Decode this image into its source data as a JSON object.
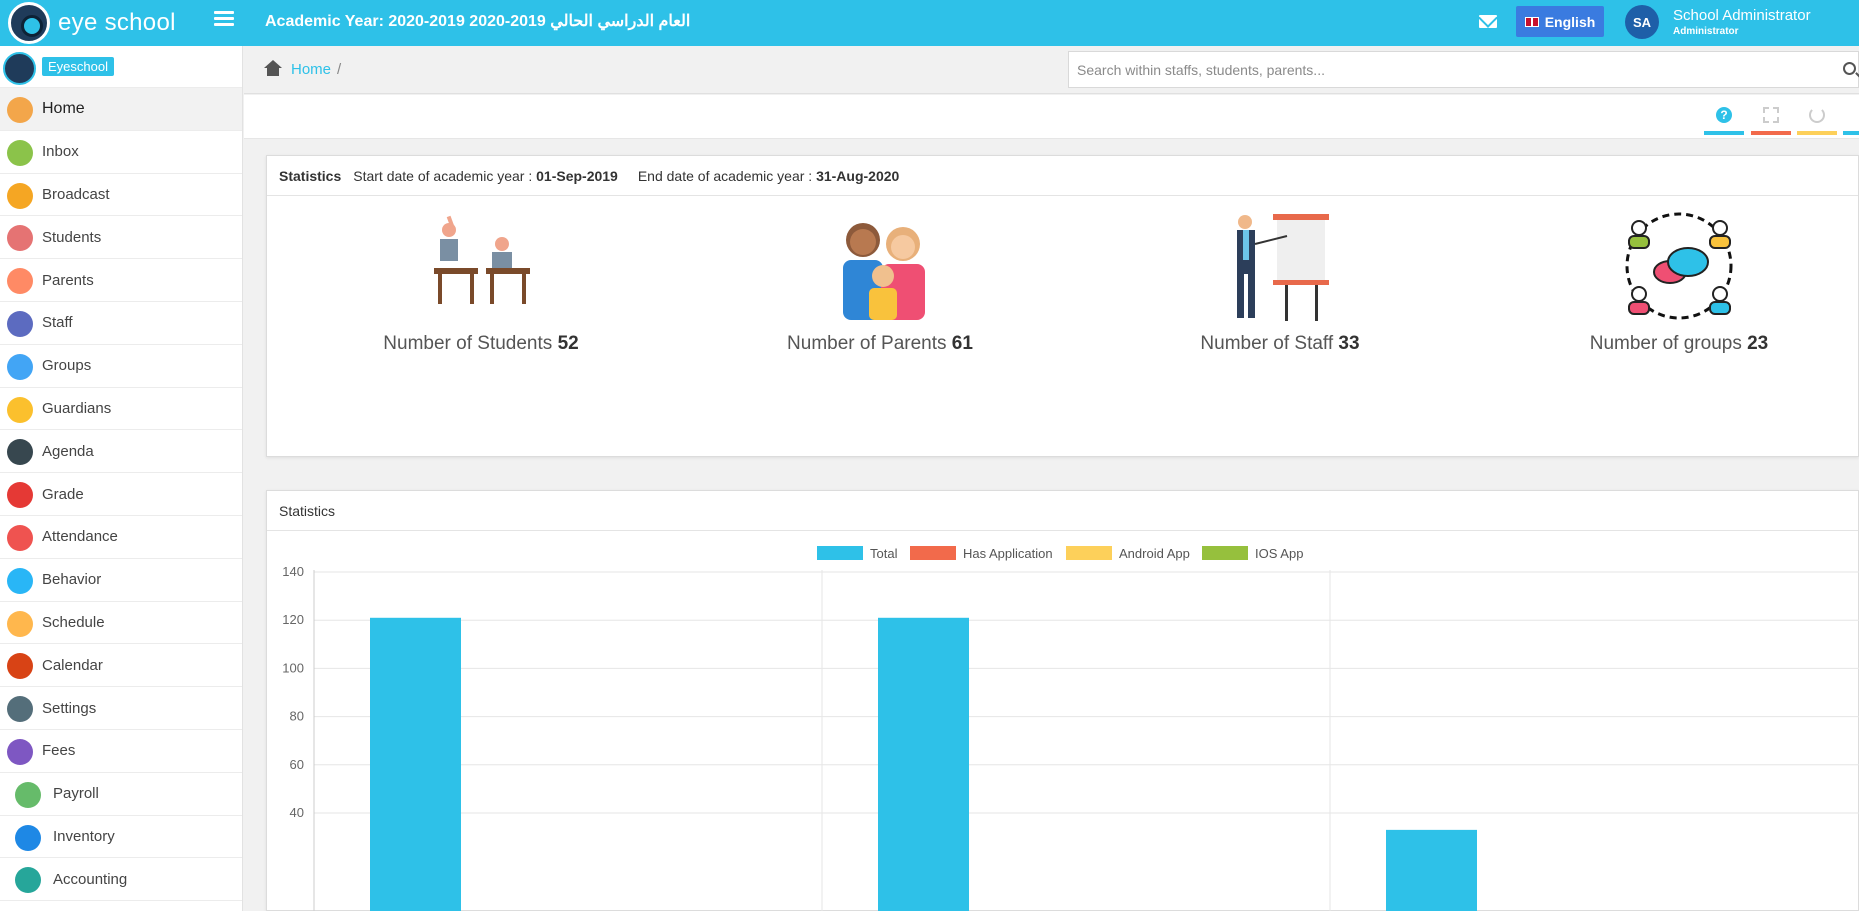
{
  "topbar": {
    "logo_text": "eye school",
    "academic_year": "Academic Year: 2020-2019 العام الدراسي الحالي 2019-2020",
    "language": "English",
    "avatar_initials": "SA",
    "user_name": "School Administrator",
    "user_role": "Administrator"
  },
  "sidebar": {
    "brand_badge": "Eyeschool",
    "items": [
      {
        "label": "Home",
        "color": "#f3a64a"
      },
      {
        "label": "Inbox",
        "color": "#8bc34a"
      },
      {
        "label": "Broadcast",
        "color": "#f5a623"
      },
      {
        "label": "Students",
        "color": "#e57373"
      },
      {
        "label": "Parents",
        "color": "#ff8a65"
      },
      {
        "label": "Staff",
        "color": "#5c6bc0"
      },
      {
        "label": "Groups",
        "color": "#42a5f5"
      },
      {
        "label": "Guardians",
        "color": "#fbc02d"
      },
      {
        "label": "Agenda",
        "color": "#37474f"
      },
      {
        "label": "Grade",
        "color": "#e53935"
      },
      {
        "label": "Attendance",
        "color": "#ef5350"
      },
      {
        "label": "Behavior",
        "color": "#29b6f6"
      },
      {
        "label": "Schedule",
        "color": "#ffb74d"
      },
      {
        "label": "Calendar",
        "color": "#d84315"
      },
      {
        "label": "Settings",
        "color": "#546e7a"
      },
      {
        "label": "Fees",
        "color": "#7e57c2"
      },
      {
        "label": "Payroll",
        "color": "#66bb6a"
      },
      {
        "label": "Inventory",
        "color": "#1e88e5"
      },
      {
        "label": "Accounting",
        "color": "#26a69a"
      }
    ]
  },
  "breadcrumb": {
    "home": "Home",
    "separator": "/"
  },
  "search": {
    "placeholder": "Search within staffs, students, parents..."
  },
  "toolbar": {
    "help": "?",
    "colors": [
      "#2ec1e8",
      "#f26a4b",
      "#fdd05a",
      "#2ec1e8"
    ]
  },
  "stats": {
    "title": "Statistics",
    "start_label": "Start date of academic year :",
    "start_date": "01-Sep-2019",
    "end_label": "End date of academic year :",
    "end_date": "31-Aug-2020",
    "cards": [
      {
        "label": "Number of Students",
        "value": "52"
      },
      {
        "label": "Number of Parents",
        "value": "61"
      },
      {
        "label": "Number of Staff",
        "value": "33"
      },
      {
        "label": "Number of groups",
        "value": "23"
      }
    ]
  },
  "chart_panel": {
    "title": "Statistics"
  },
  "chart_data": {
    "type": "bar",
    "series": [
      {
        "name": "Total",
        "color": "#2ec1e8",
        "values": [
          121,
          121,
          33
        ]
      },
      {
        "name": "Has Application",
        "color": "#f26a4b",
        "values": [
          null,
          null,
          null
        ]
      },
      {
        "name": "Android App",
        "color": "#fdd05a",
        "values": [
          null,
          null,
          null
        ]
      },
      {
        "name": "IOS App",
        "color": "#96c03d",
        "values": [
          null,
          null,
          null
        ]
      }
    ],
    "categories": [
      "",
      "",
      ""
    ],
    "yticks": [
      140,
      120,
      100,
      80,
      60,
      40
    ],
    "ylim": [
      0,
      140
    ],
    "grid": true,
    "legend_position": "top"
  }
}
